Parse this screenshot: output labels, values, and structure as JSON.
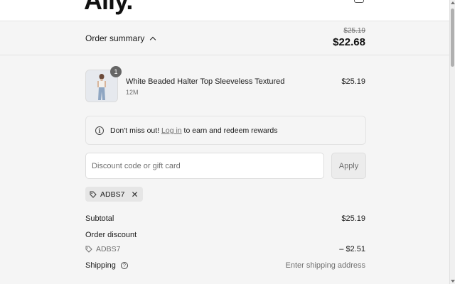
{
  "header": {
    "logo_text": "Ally.",
    "cart_icon": "bag-icon"
  },
  "summary": {
    "toggle_label": "Order summary",
    "chevron_icon": "chevron-up-icon",
    "original_total": "$25.19",
    "final_total": "$22.68"
  },
  "product": {
    "quantity": "1",
    "name": "White Beaded Halter Top Sleeveless Textured",
    "variant": "12M",
    "price": "$25.19"
  },
  "rewards": {
    "icon": "info-icon",
    "text_before": "Don't miss out! ",
    "link_text": "Log in",
    "text_after": " to earn and redeem rewards"
  },
  "discount": {
    "placeholder": "Discount code or gift card",
    "value": "",
    "apply_label": "Apply",
    "applied_code": "ADBS7",
    "tag_icon": "tag-icon",
    "remove_icon": "close-icon"
  },
  "totals": {
    "subtotal_label": "Subtotal",
    "subtotal_value": "$25.19",
    "order_discount_label": "Order discount",
    "discount_code": "ADBS7",
    "discount_value": "– $2.51",
    "shipping_label": "Shipping",
    "shipping_value": "Enter shipping address"
  },
  "colors": {
    "background": "#f5f5f5",
    "text": "#1a1a1a",
    "muted": "#707070",
    "badge": "#666666"
  }
}
